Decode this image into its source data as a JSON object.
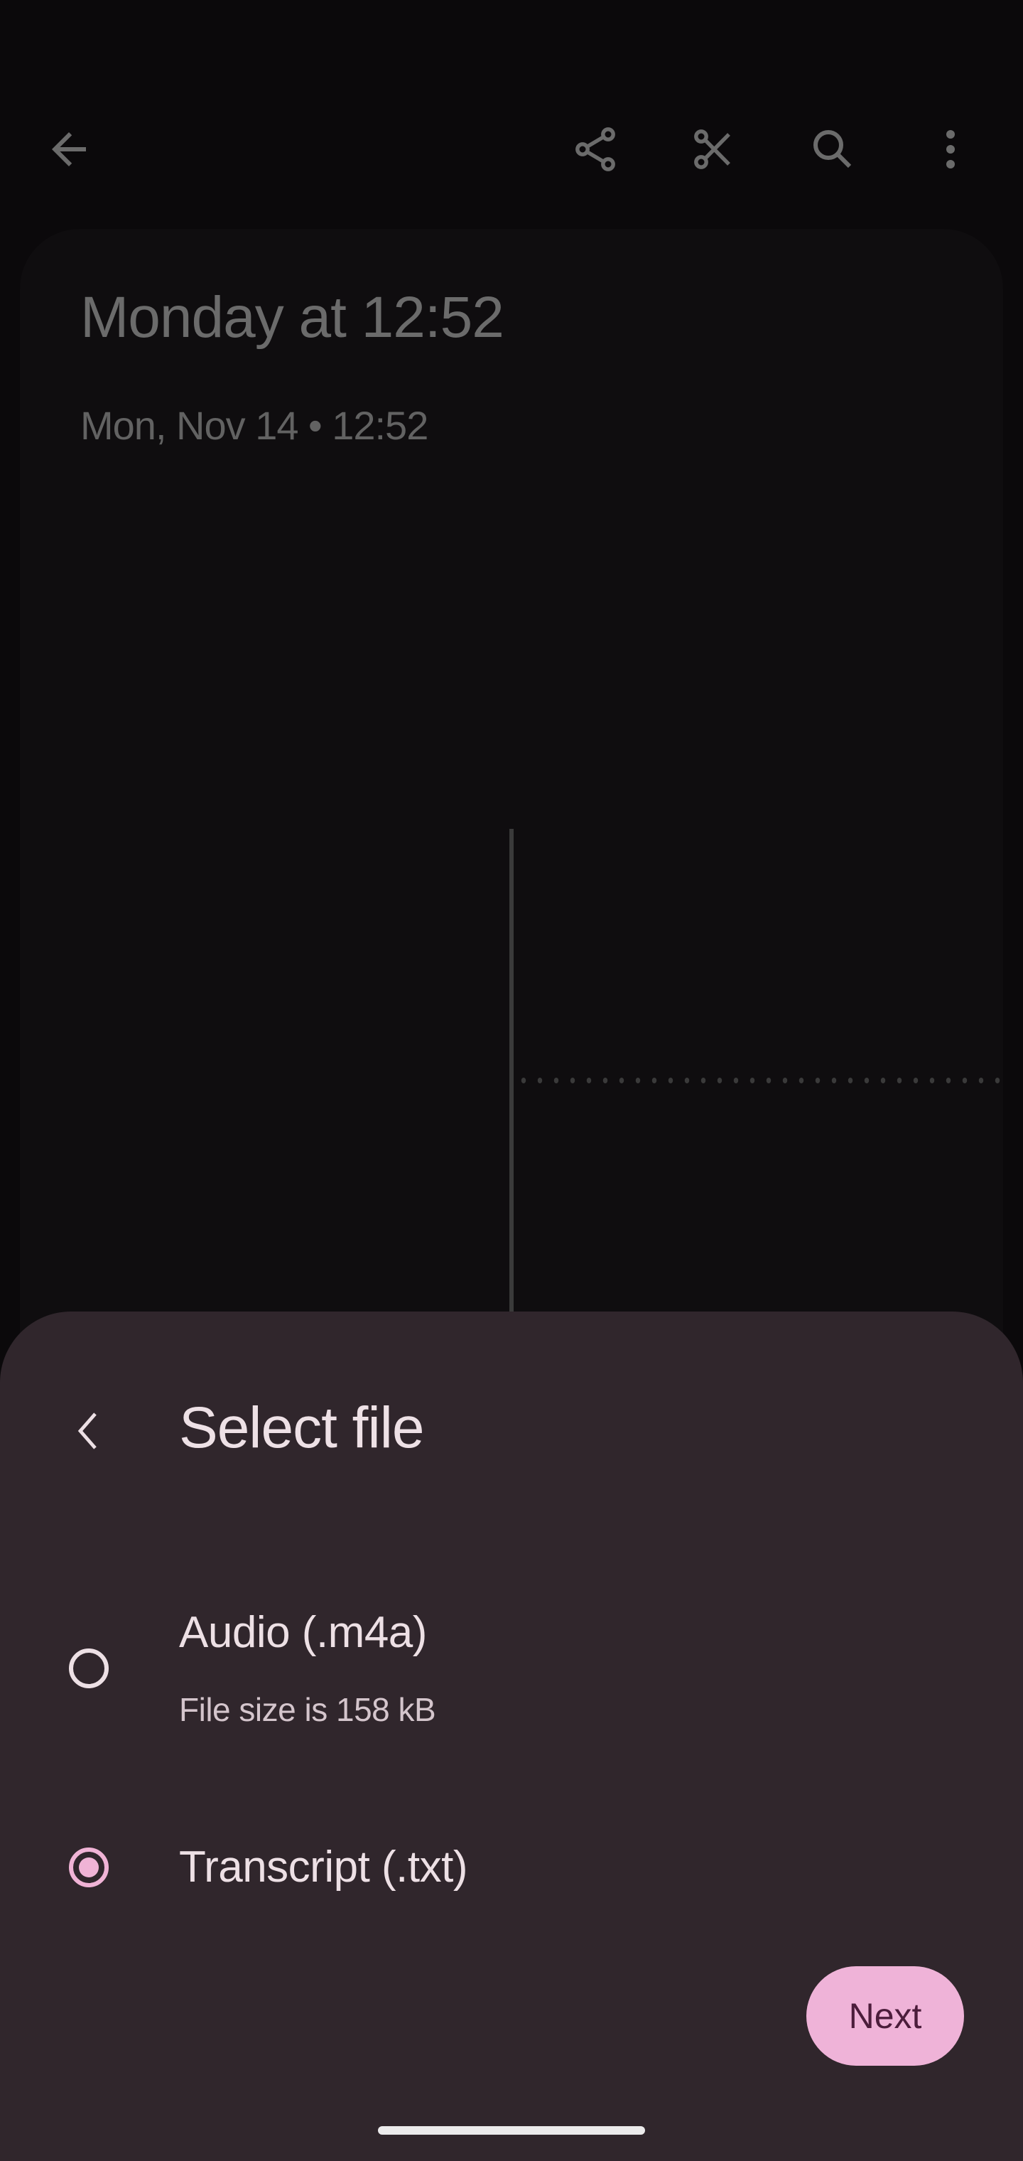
{
  "toolbar": {
    "back_icon": "arrow-back-icon",
    "actions": [
      {
        "name": "share",
        "icon": "share-icon"
      },
      {
        "name": "trim",
        "icon": "scissors-icon"
      },
      {
        "name": "search",
        "icon": "search-icon"
      },
      {
        "name": "more",
        "icon": "more-vert-icon"
      }
    ]
  },
  "recording": {
    "title": "Monday at 12:52",
    "subtitle": "Mon, Nov 14 • 12:52"
  },
  "sheet": {
    "back_icon": "chevron-left-icon",
    "title": "Select file",
    "options": [
      {
        "label": "Audio (.m4a)",
        "detail": "File size is 158 kB",
        "selected": false
      },
      {
        "label": "Transcript (.txt)",
        "detail": "",
        "selected": true
      }
    ],
    "next_label": "Next"
  },
  "colors": {
    "accent": "#f0b3d6",
    "button_bg": "#efb3d8",
    "button_text": "#4b1d3b",
    "sheet_bg": "#30262c",
    "page_bg": "#0b090b"
  }
}
